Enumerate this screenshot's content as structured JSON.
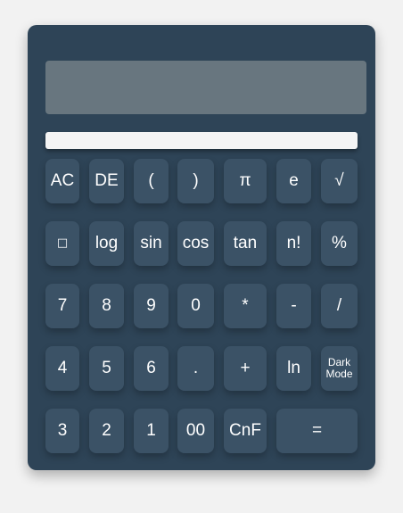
{
  "display": {
    "value": "",
    "input_value": ""
  },
  "buttons": {
    "row1": [
      "AC",
      "DE",
      "(",
      ")",
      "π",
      "e",
      "√"
    ],
    "row2": [
      "□",
      "log",
      "sin",
      "cos",
      "tan",
      "n!",
      "%"
    ],
    "row3": [
      "7",
      "8",
      "9",
      "0",
      "*",
      "-",
      "/"
    ],
    "row4": [
      "4",
      "5",
      "6",
      ".",
      "+",
      "ln",
      "Dark Mode"
    ],
    "row5": [
      "3",
      "2",
      "1",
      "00",
      "CnF",
      "="
    ]
  },
  "colors": {
    "page_bg": "#f2f2f2",
    "body_bg": "#2e4457",
    "button_bg": "#3b5266",
    "display_bg": "#68767f",
    "text": "#ffffff"
  }
}
